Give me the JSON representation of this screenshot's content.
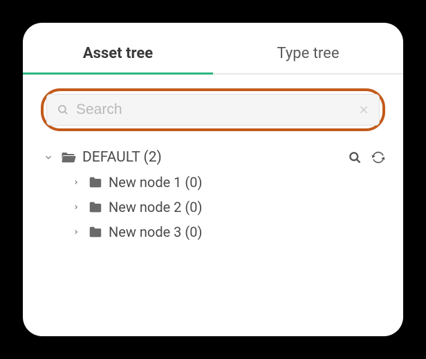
{
  "tabs": {
    "asset": "Asset tree",
    "type": "Type tree",
    "active": "asset"
  },
  "search": {
    "placeholder": "Search",
    "value": ""
  },
  "tree": {
    "root": {
      "label": "DEFAULT (2)",
      "expanded": true
    },
    "children": [
      {
        "label": "New node 1 (0)"
      },
      {
        "label": "New node 2 (0)"
      },
      {
        "label": "New node 3 (0)"
      }
    ]
  }
}
